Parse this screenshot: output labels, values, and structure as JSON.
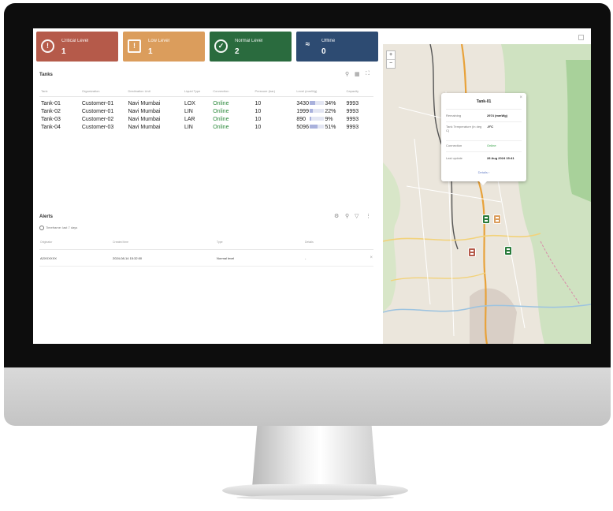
{
  "colors": {
    "critical": "#b55a4a",
    "low": "#db9d5c",
    "normal": "#2a6b3e",
    "offline": "#2d4b72",
    "online": "#2c8a3c",
    "level_bar": "#a9b1dc"
  },
  "cards": {
    "critical": {
      "label": "Critical Level",
      "count": "1",
      "icon": "tank-alert-icon"
    },
    "low": {
      "label": "Low Level",
      "count": "1",
      "icon": "warning-icon"
    },
    "normal": {
      "label": "Normal Level",
      "count": "2",
      "icon": "check-icon"
    },
    "offline": {
      "label": "Offline",
      "count": "0",
      "icon": "wifi-off-icon"
    }
  },
  "tanks": {
    "title": "Tanks",
    "columns": [
      "Tank",
      "Organization",
      "Destination Unit",
      "Liquid Type",
      "Connection",
      "Pressure (bar)",
      "Level (mmWg)",
      "Capacity"
    ],
    "rows": [
      {
        "tank": "Tank-01",
        "org": "Customer-01",
        "dest": "Navi Mumbai",
        "type": "LOX",
        "conn": "Online",
        "pressure": "10",
        "level": "3430",
        "pct": "34%",
        "pct_value": 34,
        "capacity": "9993"
      },
      {
        "tank": "Tank-02",
        "org": "Customer-01",
        "dest": "Navi Mumbai",
        "type": "LIN",
        "conn": "Online",
        "pressure": "10",
        "level": "1999",
        "pct": "22%",
        "pct_value": 22,
        "capacity": "9993"
      },
      {
        "tank": "Tank-03",
        "org": "Customer-02",
        "dest": "Navi Mumbai",
        "type": "LAR",
        "conn": "Online",
        "pressure": "10",
        "level": "890",
        "pct": "9%",
        "pct_value": 9,
        "capacity": "9993"
      },
      {
        "tank": "Tank-04",
        "org": "Customer-03",
        "dest": "Navi Mumbai",
        "type": "LIN",
        "conn": "Online",
        "pressure": "10",
        "level": "5096",
        "pct": "51%",
        "pct_value": 51,
        "capacity": "9993"
      }
    ]
  },
  "alerts": {
    "title": "Alerts",
    "filter": "Timeframe: last 7 days",
    "columns": [
      "Originator",
      "Created time",
      "Type",
      "Details"
    ],
    "rows": [
      {
        "originator": "A2XXXXXX",
        "created": "2024-08-14 15:32:00",
        "type": "Normal level",
        "details": "-"
      }
    ]
  },
  "map": {
    "popup": {
      "title": "Tank-01",
      "rows": [
        {
          "key": "Remaining",
          "value": "2974 (mmWg)"
        },
        {
          "key": "Tank Temperature (in deg C)",
          "value": "-9°C"
        },
        {
          "key": "Connection",
          "value": "Online"
        },
        {
          "key": "Last update",
          "value": "28 Aug 2024 15:41"
        }
      ],
      "details_link": "Details"
    }
  }
}
